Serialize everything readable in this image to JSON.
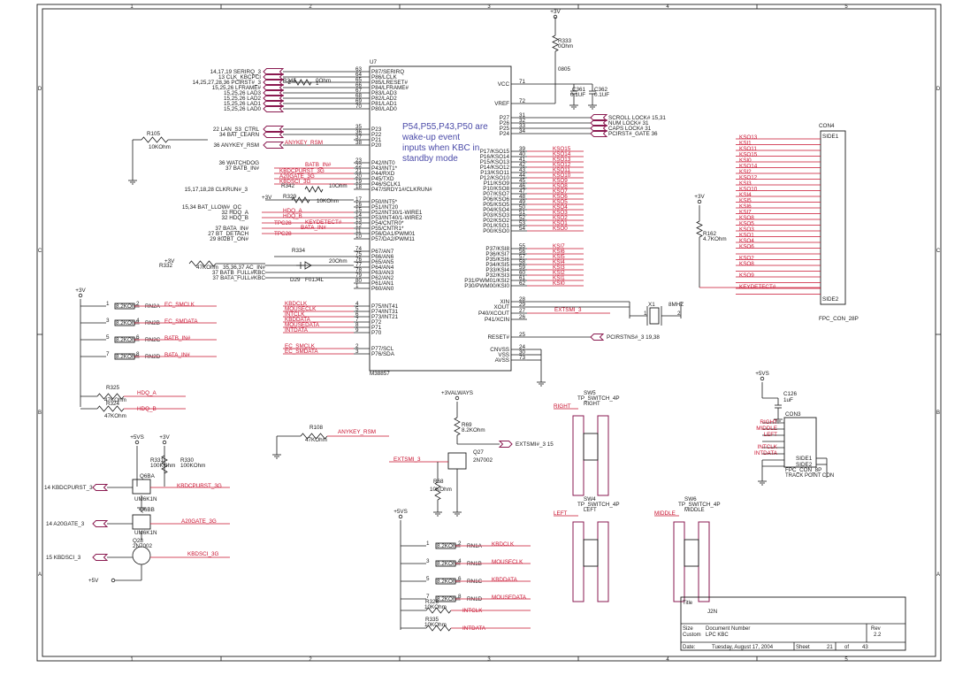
{
  "frame": {
    "cols": [
      "5",
      "4",
      "3",
      "2",
      "1"
    ],
    "rows": [
      "D",
      "C",
      "B",
      "A"
    ]
  },
  "u7": {
    "ref": "U7",
    "part": "M38857",
    "left_pins": [
      {
        "num": "63",
        "name": "P87/SERIRQ",
        "net": "14,17,19  SERIRQ_3"
      },
      {
        "num": "64",
        "name": "P86/LCLK",
        "net": "13  CLK_KBCPCI"
      },
      {
        "num": "65",
        "name": "P85/LRESET#",
        "net": "14,25,27,28,36  PCIRST#_3"
      },
      {
        "num": "66",
        "name": "P84/LFRAME#",
        "net": "15,25,26  LFRAME#"
      },
      {
        "num": "67",
        "name": "P83/LAD3",
        "net": "15,25,26  LAD3"
      },
      {
        "num": "68",
        "name": "P82/LAD2",
        "net": "15,25,26  LAD2"
      },
      {
        "num": "69",
        "name": "P81/LAD1",
        "net": "15,25,26  LAD1"
      },
      {
        "num": "70",
        "name": "P80/LAD0",
        "net": "15,25,26  LAD0"
      },
      {
        "num": "35",
        "name": "P23",
        "net": "22  LAN_S3_CTRL"
      },
      {
        "num": "36",
        "name": "P22",
        "net": "34  BAT_LEARN"
      },
      {
        "num": "37",
        "name": "P21",
        "net": ""
      },
      {
        "num": "38",
        "name": "P20",
        "net": "36  ANYKEY_RSM"
      },
      {
        "num": "23",
        "name": "P42/INT0",
        "net": "36  WATCHDOG"
      },
      {
        "num": "22",
        "name": "P43/INT1*",
        "net": "37  BATB_IN#"
      },
      {
        "num": "21",
        "name": "P44/RXD",
        "net": ""
      },
      {
        "num": "20",
        "name": "P45/TXD",
        "net": ""
      },
      {
        "num": "19",
        "name": "P46/SCLK1",
        "net": ""
      },
      {
        "num": "18",
        "name": "P47/SRDY1#/CLKRUN#",
        "net": "15,17,18,28  CLKRUN#_3"
      },
      {
        "num": "17",
        "name": "P50/INT5*",
        "net": ""
      },
      {
        "num": "16",
        "name": "P51/INT20",
        "net": "15,34  BAT_LLOW#_OC"
      },
      {
        "num": "15",
        "name": "P52/INT30/1-WIRE1",
        "net": "32  HDQ_A"
      },
      {
        "num": "14",
        "name": "P53/INT40/1-WIRE2",
        "net": "32  HDQ_B"
      },
      {
        "num": "13",
        "name": "P54/CNTR0*",
        "net": ""
      },
      {
        "num": "12",
        "name": "P55/CNTR1*",
        "net": "37  BATA_IN#"
      },
      {
        "num": "11",
        "name": "P56/DA1/PWM01",
        "net": "27  BT_DETACH"
      },
      {
        "num": "10",
        "name": "P57/DA2/PWM11",
        "net": "29  802BT_ON#"
      },
      {
        "num": "74",
        "name": "P67/AN7",
        "net": "+VCORE"
      },
      {
        "num": "75",
        "name": "P66/AN6",
        "net": ""
      },
      {
        "num": "76",
        "name": "P65/AN5",
        "net": ""
      },
      {
        "num": "77",
        "name": "P64/AN4",
        "net": "35,36,37  AC_IN#"
      },
      {
        "num": "78",
        "name": "P63/AN3",
        "net": "37  BATB_FULL#KBC"
      },
      {
        "num": "79",
        "name": "P62/AN2",
        "net": "37  BATA_FULL#KBC"
      },
      {
        "num": "80",
        "name": "P61/AN1",
        "net": ""
      },
      {
        "num": "1",
        "name": "P60/AN0",
        "net": ""
      },
      {
        "num": "4",
        "name": "P75/INT41",
        "net": "KBDCLK"
      },
      {
        "num": "5",
        "name": "P74/INT31",
        "net": "MOUSECLK"
      },
      {
        "num": "6",
        "name": "P73/INT21",
        "net": "INTCLK"
      },
      {
        "num": "7",
        "name": "P72",
        "net": "KBDDATA"
      },
      {
        "num": "8",
        "name": "P71",
        "net": "MOUSEDATA"
      },
      {
        "num": "9",
        "name": "P70",
        "net": "INTDATA"
      },
      {
        "num": "2",
        "name": "P77/SCL",
        "net": "EC_SMCLK"
      },
      {
        "num": "3",
        "name": "P76/SDA",
        "net": "EC_SMDATA"
      }
    ],
    "right_pins": [
      {
        "num": "71",
        "name": "VCC"
      },
      {
        "num": "72",
        "name": "VREF"
      },
      {
        "num": "31",
        "name": "P27",
        "net": "SCROLL LOCK#  15,31"
      },
      {
        "num": "32",
        "name": "P26",
        "net": "NUM LOCK#  31"
      },
      {
        "num": "33",
        "name": "P25",
        "net": "CAPS LOCK#  31"
      },
      {
        "num": "34",
        "name": "P24",
        "net": "PCIRST#_GATE  36"
      },
      {
        "num": "39",
        "name": "P17/KSO15",
        "net": "KSO15"
      },
      {
        "num": "40",
        "name": "P16/KSO14",
        "net": "KSO14"
      },
      {
        "num": "41",
        "name": "P15/KSO13",
        "net": "KSO13"
      },
      {
        "num": "42",
        "name": "P14/KSO12",
        "net": "KSO12"
      },
      {
        "num": "43",
        "name": "P13/KSO11",
        "net": "KSO11"
      },
      {
        "num": "44",
        "name": "P12/KSO10",
        "net": "KSO10"
      },
      {
        "num": "45",
        "name": "P11/KSO9",
        "net": "KSO9"
      },
      {
        "num": "46",
        "name": "P10/KSO8",
        "net": "KSO8"
      },
      {
        "num": "47",
        "name": "P07/KSO7",
        "net": "KSO7"
      },
      {
        "num": "48",
        "name": "P06/KSO6",
        "net": "KSO6"
      },
      {
        "num": "49",
        "name": "P05/KSO5",
        "net": "KSO5"
      },
      {
        "num": "50",
        "name": "P04/KSO4",
        "net": "KSO4"
      },
      {
        "num": "51",
        "name": "P03/KSO3",
        "net": "KSO3"
      },
      {
        "num": "52",
        "name": "P02/KSO2",
        "net": "KSO2"
      },
      {
        "num": "53",
        "name": "P01/KSO1",
        "net": "KSO1"
      },
      {
        "num": "54",
        "name": "P00/KSO0",
        "net": "KSO0"
      },
      {
        "num": "55",
        "name": "P37/KSI8",
        "net": "KSI7"
      },
      {
        "num": "56",
        "name": "P36/KSI7",
        "net": "KSI6"
      },
      {
        "num": "57",
        "name": "P35/KSI6",
        "net": "KSI5"
      },
      {
        "num": "58",
        "name": "P34/KSI5",
        "net": "KSI4"
      },
      {
        "num": "59",
        "name": "P33/KSI4",
        "net": "KSI3"
      },
      {
        "num": "60",
        "name": "P32/KSI3",
        "net": "KSI2"
      },
      {
        "num": "61",
        "name": "P31/PWM01/KSI2",
        "net": "KSI1"
      },
      {
        "num": "62",
        "name": "P30/PWM00/KSI0",
        "net": "KSI0"
      },
      {
        "num": "28",
        "name": "XIN"
      },
      {
        "num": "29",
        "name": "XOUT"
      },
      {
        "num": "27",
        "name": "P40/XCOUT",
        "net": "EXTSMI_3"
      },
      {
        "num": "26",
        "name": "P41/XCIN"
      },
      {
        "num": "25",
        "name": "RESET#",
        "net": "PCIRSTNS#_3  19,38"
      },
      {
        "num": "24",
        "name": "CNVSS"
      },
      {
        "num": "30",
        "name": "VSS"
      },
      {
        "num": "73",
        "name": "AVSS"
      }
    ]
  },
  "note": [
    "P54,P55,P43,P50 are",
    "wake-up event",
    "inputs when KBC in",
    "standby mode"
  ],
  "top": {
    "pwr": "+3V",
    "r333": "R333",
    "r333v": "0Ohm",
    "r333p": "0805",
    "c361": "C361",
    "c361v": "0.1UF",
    "c362": "C362",
    "c362v": "0.1UF"
  },
  "misc": {
    "r345": "R345",
    "r345v": "0Ohm",
    "r345a": "2",
    "r345b": "1",
    "r105": "R105",
    "r105v": "10KOhm",
    "anykey": "ANYKEY_RSM",
    "batb": "BATB_IN#",
    "kbdcpurst": "KBDCPURST_3G",
    "a20": "A20GATE_3G",
    "kbdsci": "KBDSCI_3G",
    "r342": "R342",
    "r342v": "10Ohm",
    "r329": "R329",
    "r329v": "10KOhm",
    "p3v": "+3V",
    "hdqa": "HDQ_A",
    "hdqb": "HDQ_B",
    "tpc28": "TPC28",
    "kbddet": "KEYDETECT#",
    "bataIn": "BATA_IN#",
    "vcore": "+VCORE",
    "r334": "R334",
    "r334v": "20Ohm",
    "d29": "D29",
    "d29v": "F01J4L",
    "r332": "R332",
    "r332v": "47KOhm",
    "p3vb": "+3V"
  },
  "rn_left": {
    "pwr": "+3V",
    "items": [
      {
        "ref": "RN2A",
        "val": "8.2KOhm",
        "net": "EC_SMCLK",
        "p1": "1",
        "p2": "2"
      },
      {
        "ref": "RN2B",
        "val": "8.2KOhm",
        "net": "EC_SMDATA",
        "p1": "3",
        "p2": "4"
      },
      {
        "ref": "RN2C",
        "val": "8.2KOhm",
        "net": "BATB_IN#",
        "p1": "5",
        "p2": "6"
      },
      {
        "ref": "RN2D",
        "val": "8.2KOhm",
        "net": "BATA_IN#",
        "p1": "7",
        "p2": "8"
      }
    ],
    "r325": "R325",
    "r325v": "47KOhm",
    "r324": "R324",
    "r324v": "47KOhm",
    "hdqa": "HDQ_A",
    "hdqb": "HDQ_B"
  },
  "r108": {
    "ref": "R108",
    "val": "47KOhm",
    "net": "ANYKEY_RSM"
  },
  "fets": {
    "p5vs": "+5VS",
    "p3v": "+3V",
    "r331": "R331",
    "r331v": "100KOhm",
    "r330": "R330",
    "r330v": "100KOhm",
    "q6ba": "Q6BA",
    "q6ba_p": "UM6K1N",
    "q6bb": "Q6BB",
    "q6bb_p": "UM6K1N",
    "q28": "Q28",
    "q28_p": "2N7002",
    "kbdcp": "14  KBDCPURST_3",
    "a20": "14  A20GATE_3",
    "kbdsci": "15  KBDSCI_3",
    "kbdcp_g": "KBDCPURST_3G",
    "a20_g": "A20GATE_3G",
    "kbdsci_g": "KBDSCI_3G",
    "p5v": "+5V"
  },
  "q27": {
    "pwr": "+3VALWAYS",
    "r69": "R69",
    "r69v": "8.2KOhm",
    "ref": "Q27",
    "part": "2N7002",
    "r68": "R68",
    "r68v": "10KOhm",
    "out": "EXTSMI#_3  15",
    "in": "EXTSMI_3"
  },
  "rn1": {
    "pwr": "+5VS",
    "items": [
      {
        "ref": "RN1A",
        "val": "8.2KOhm",
        "net": "KBDCLK",
        "p1": "1",
        "p2": "2"
      },
      {
        "ref": "RN1B",
        "val": "8.2KOhm",
        "net": "MOUSECLK",
        "p1": "3",
        "p2": "4"
      },
      {
        "ref": "RN1C",
        "val": "8.2KOhm",
        "net": "KBDDATA",
        "p1": "5",
        "p2": "6"
      },
      {
        "ref": "RN1D",
        "val": "8.2KOhm",
        "net": "MOUSEDATA",
        "p1": "7",
        "p2": "8"
      }
    ],
    "r326": "R326",
    "r326v": "10KOhm",
    "intclk": "INTCLK",
    "r335": "R335",
    "r335v": "10KOhm",
    "intdata": "INTDATA"
  },
  "xtal": {
    "ref": "X1",
    "val": "8MHZ",
    "p1": "1",
    "p2": "2"
  },
  "sw": [
    {
      "ref": "SW5",
      "part": "TP_SWITCH_4P",
      "sub": "RIGHT",
      "net": "RIGHT"
    },
    {
      "ref": "SW4",
      "part": "TP_SWITCH_4P",
      "sub": "LEFT",
      "net": "LEFT"
    },
    {
      "ref": "SW6",
      "part": "TP_SWITCH_4P",
      "sub": "MIDDLE",
      "net": "MIDDLE"
    }
  ],
  "con3": {
    "ref": "CON3",
    "part": "FPC_CON_8P",
    "sub": "TRACK POINT CON",
    "pwr": "+5VS",
    "c126": "C126",
    "c126v": "1uF",
    "nets": [
      "RIGHT",
      "MIDDLE",
      "LEFT",
      "",
      "INTCLK",
      "INTDATA",
      "",
      ""
    ],
    "side1": "SIDE1",
    "side2": "SIDE2"
  },
  "con4": {
    "ref": "CON4",
    "part": "FPC_CON_28P",
    "side1": "SIDE1",
    "side2": "SIDE2",
    "nets": [
      "KSO13",
      "KSI1",
      "KSO11",
      "KSO15",
      "KSI0",
      "KSO14",
      "KSI2",
      "KSO12",
      "KSI3",
      "KSO10",
      "KSI4",
      "KSI5",
      "KSI6",
      "KSI7",
      "KSO8",
      "KSO5",
      "KSO3",
      "KSO1",
      "KSO4",
      "KSO6",
      "",
      "KSO2",
      "KSO8",
      "",
      "KSO9",
      "",
      "KEYDETECT#",
      ""
    ],
    "r162": "R162",
    "r162v": "4.7KOhm",
    "pwr": "+3V"
  },
  "title": {
    "l_title": "Title",
    "title": "J2N",
    "l_size": "Size",
    "size": "Custom",
    "l_doc": "Document Number",
    "doc": "LPC KBC",
    "l_rev": "Rev",
    "rev": "2.2",
    "l_date": "Date:",
    "date": "Tuesday, August 17, 2004",
    "l_sheet": "Sheet",
    "sheet": "21",
    "l_of": "of",
    "of": "43"
  }
}
